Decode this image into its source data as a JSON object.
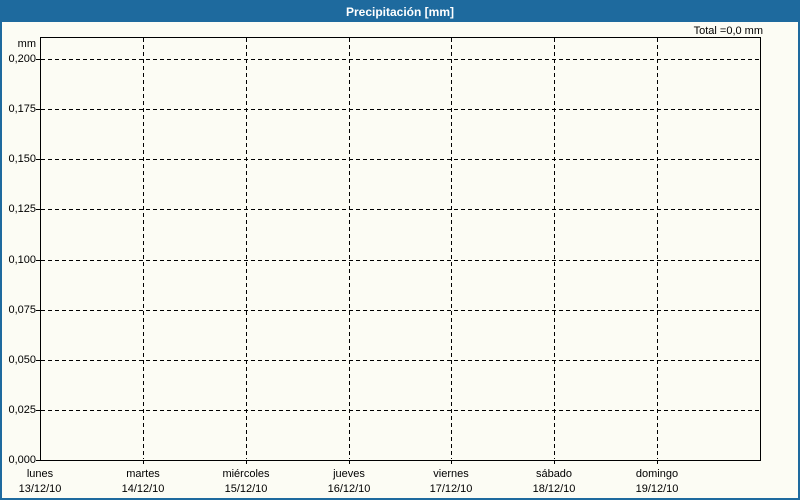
{
  "window": {
    "title": "Precipitación [mm]"
  },
  "summary": {
    "total_label": "Total =0,0 mm"
  },
  "chart_data": {
    "type": "bar",
    "title": "Precipitación [mm]",
    "xlabel": "",
    "ylabel": "mm",
    "ylim": [
      0,
      0.2
    ],
    "ytick_step": 0.025,
    "ytick_labels": [
      "0,200",
      "0,175",
      "0,150",
      "0,125",
      "0,100",
      "0,075",
      "0,050",
      "0,025",
      "0,000"
    ],
    "categories": [
      "lunes",
      "martes",
      "miércoles",
      "jueves",
      "viernes",
      "sábado",
      "domingo"
    ],
    "category_dates": [
      "13/12/10",
      "14/12/10",
      "15/12/10",
      "16/12/10",
      "17/12/10",
      "18/12/10",
      "19/12/10"
    ],
    "values": [
      0,
      0,
      0,
      0,
      0,
      0,
      0
    ],
    "total_precipitation_mm": 0.0,
    "total_label": "Total =0,0 mm",
    "grid": "dashed",
    "legend": "none",
    "colors": {
      "titlebar": "#1E6A9E",
      "border": "#1E6A9E",
      "background": "#FCFCF4",
      "grid": "#000000",
      "text": "#000000"
    }
  }
}
